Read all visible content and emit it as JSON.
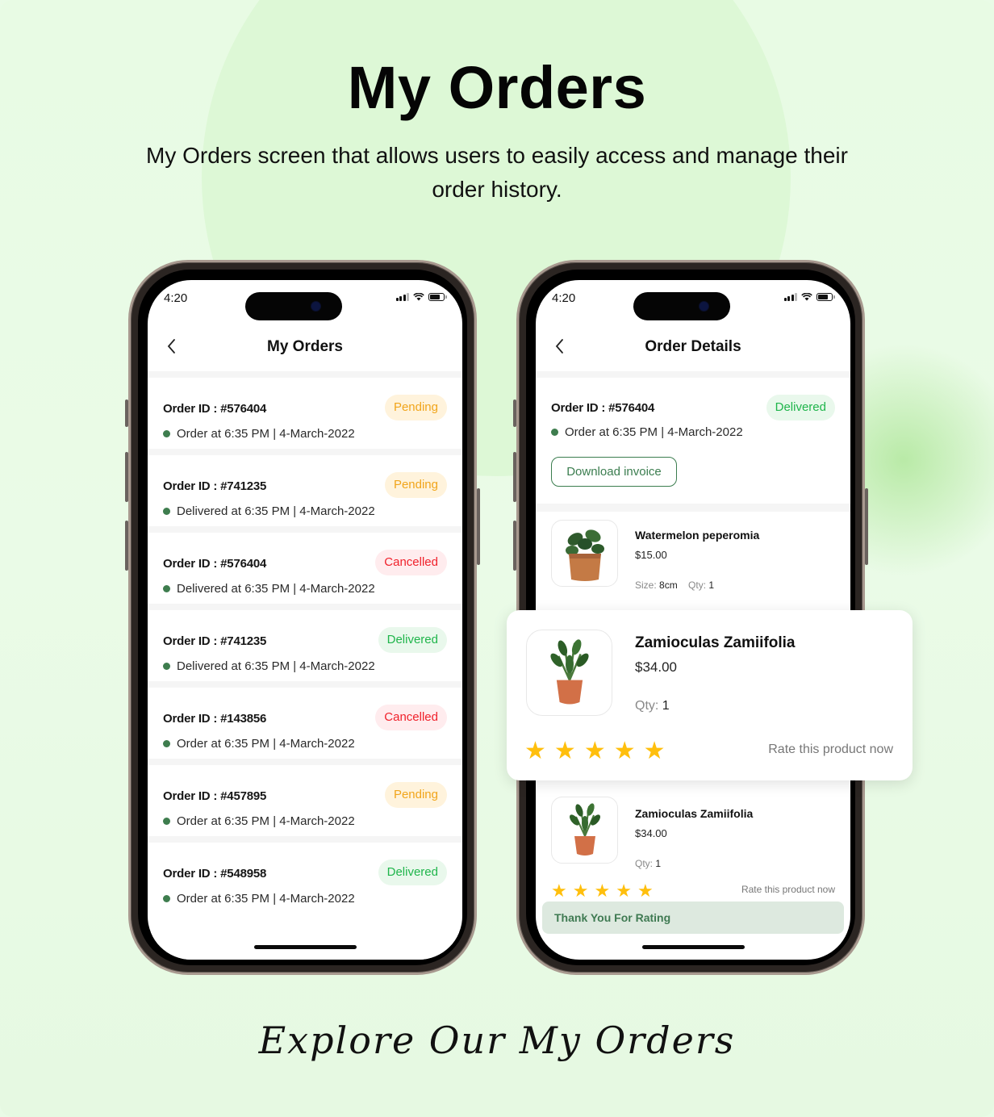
{
  "hero": {
    "title": "My Orders",
    "subtitle": "My Orders screen that allows users to easily access and manage their order history."
  },
  "footer": {
    "tagline": "Explore Our My Orders"
  },
  "colors": {
    "brand_green": "#3b7d4f",
    "pending": "#f1a51b",
    "cancelled": "#f0212b",
    "delivered": "#1fb54b",
    "star": "#ffbf0d",
    "background": "#e8fbe4"
  },
  "status_bar": {
    "time": "4:20",
    "icons": [
      "signal-icon",
      "wifi-icon",
      "battery-icon"
    ]
  },
  "orders_screen": {
    "title": "My Orders",
    "back_icon": "chevron-left-icon",
    "orders": [
      {
        "id_label": "Order ID :",
        "id": "#576404",
        "status": "Pending",
        "status_type": "pending",
        "meta": "Order at 6:35 PM | 4-March-2022"
      },
      {
        "id_label": "Order ID :",
        "id": "#741235",
        "status": "Pending",
        "status_type": "pending",
        "meta": "Delivered at 6:35 PM | 4-March-2022"
      },
      {
        "id_label": "Order ID :",
        "id": "#576404",
        "status": "Cancelled",
        "status_type": "cancelled",
        "meta": "Delivered at 6:35 PM | 4-March-2022"
      },
      {
        "id_label": "Order ID :",
        "id": "#741235",
        "status": "Delivered",
        "status_type": "delivered",
        "meta": "Delivered at 6:35 PM | 4-March-2022"
      },
      {
        "id_label": "Order ID :",
        "id": "#143856",
        "status": "Cancelled",
        "status_type": "cancelled",
        "meta": "Order at 6:35 PM | 4-March-2022"
      },
      {
        "id_label": "Order ID :",
        "id": "#457895",
        "status": "Pending",
        "status_type": "pending",
        "meta": "Order at 6:35 PM | 4-March-2022"
      },
      {
        "id_label": "Order ID :",
        "id": "#548958",
        "status": "Delivered",
        "status_type": "delivered",
        "meta": "Order at 6:35 PM | 4-March-2022"
      }
    ]
  },
  "details_screen": {
    "title": "Order Details",
    "back_icon": "chevron-left-icon",
    "order": {
      "id_label": "Order ID :",
      "id": "#576404",
      "status": "Delivered",
      "meta": "Order at 6:35 PM | 4-March-2022"
    },
    "download_invoice_label": "Download invoice",
    "products": [
      {
        "name": "Watermelon peperomia",
        "price": "$15.00",
        "size_label": "Size:",
        "size": "8cm",
        "qty_label": "Qty:",
        "qty": "1"
      },
      {
        "name": "Zamioculas Zamiifolia",
        "price": "$34.00",
        "qty_label": "Qty:",
        "qty": "1",
        "rating": 5,
        "rating_max": 5,
        "rate_label": "Rate this product now"
      }
    ],
    "toast": "Thank You For Rating"
  },
  "floating_card": {
    "name": "Zamioculas Zamiifolia",
    "price": "$34.00",
    "qty_label": "Qty:",
    "qty": "1",
    "rating": 5,
    "rating_max": 5,
    "rate_label": "Rate this product now"
  }
}
